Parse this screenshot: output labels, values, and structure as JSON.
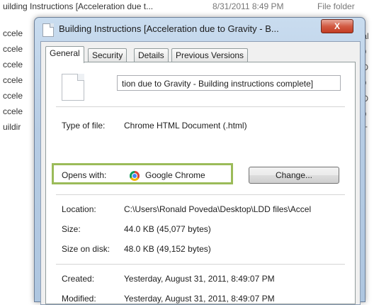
{
  "background_listing": {
    "rows": [
      {
        "name": "uilding Instructions [Acceleration due t...",
        "date": "8/31/2011 8:49 PM",
        "type": "File folder"
      },
      {
        "name": "ccele"
      },
      {
        "name": "ccele"
      },
      {
        "name": "ccele"
      },
      {
        "name": "ccele"
      },
      {
        "name": "ccele"
      },
      {
        "name": "ccele"
      },
      {
        "name": "uildir"
      }
    ],
    "right_column": [
      "tal",
      "O",
      "ID",
      "O",
      "ID",
      "O",
      "IT"
    ]
  },
  "dialog": {
    "title": "Building Instructions [Acceleration due to Gravity  - B...",
    "close_label": "X",
    "tabs": [
      "General",
      "Security",
      "Details",
      "Previous Versions"
    ],
    "file_name": "tion due to Gravity  - Building instructions complete]",
    "type_of_file": {
      "label": "Type of file:",
      "value": "Chrome HTML Document (.html)"
    },
    "opens_with": {
      "label": "Opens with:",
      "value": "Google Chrome",
      "button": "Change...",
      "icon": "chrome-icon",
      "highlight_color": "#9bbb59"
    },
    "location": {
      "label": "Location:",
      "value": "C:\\Users\\Ronald Poveda\\Desktop\\LDD files\\Accel"
    },
    "size": {
      "label": "Size:",
      "value": "44.0 KB (45,077 bytes)"
    },
    "size_on_disk": {
      "label": "Size on disk:",
      "value": "48.0 KB (49,152 bytes)"
    },
    "created": {
      "label": "Created:",
      "value": "Yesterday, August 31, 2011, 8:49:07 PM"
    },
    "modified": {
      "label": "Modified:",
      "value": "Yesterday, August 31, 2011, 8:49:07 PM"
    }
  }
}
